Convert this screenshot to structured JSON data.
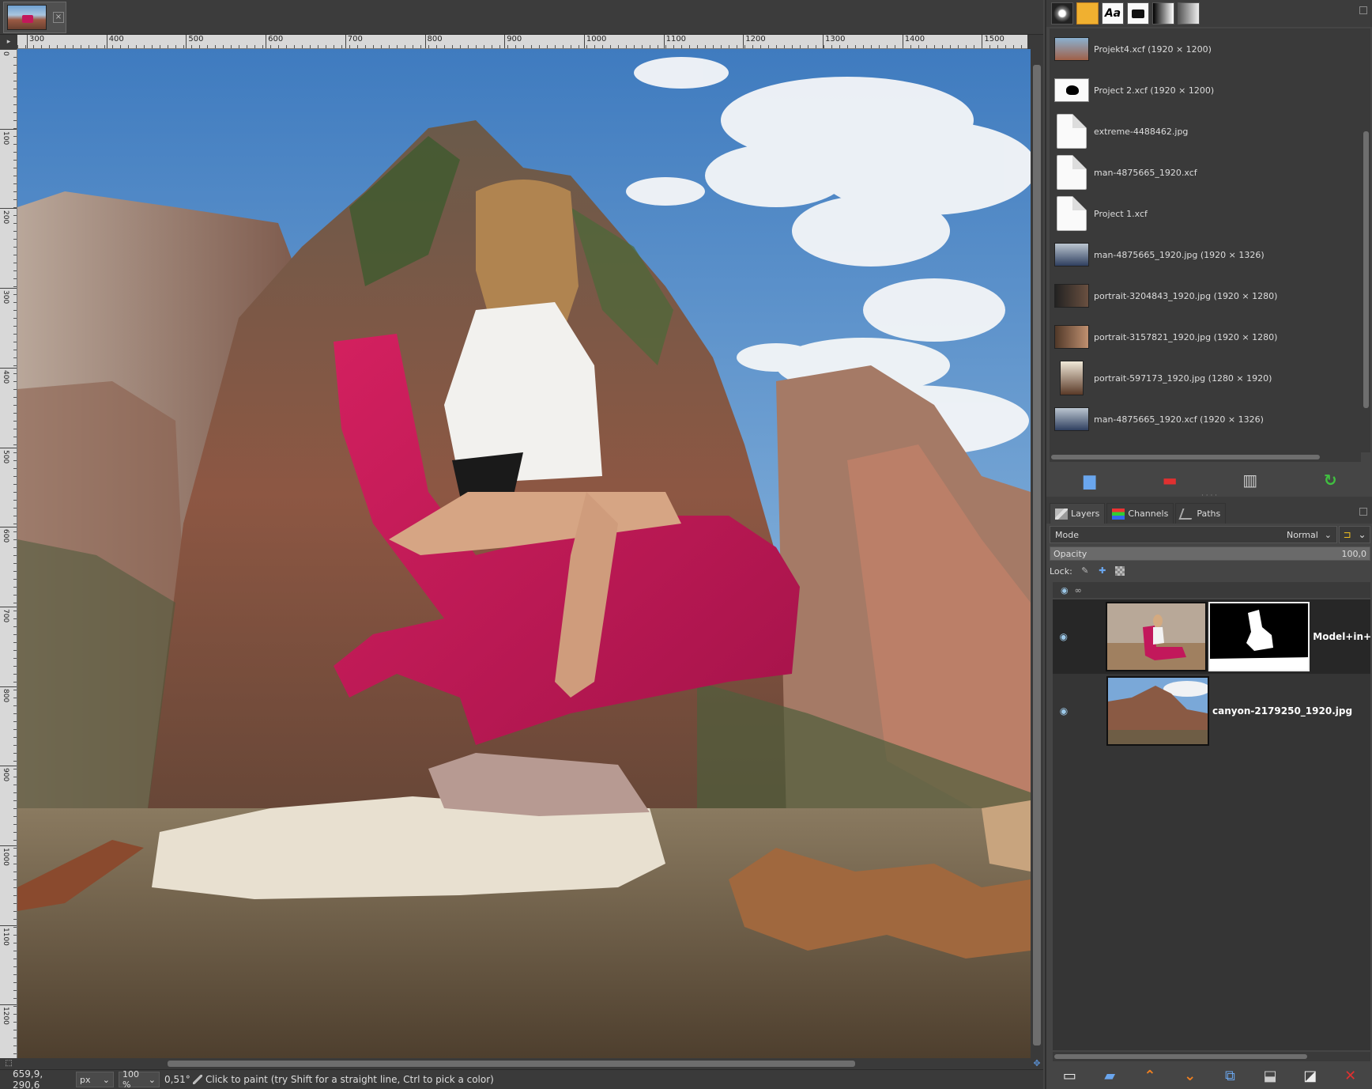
{
  "image_window": {
    "tab_close": "×",
    "ruler_corner": "▸",
    "ruler_h_ticks": [
      "300",
      "400",
      "500",
      "600",
      "700",
      "800",
      "900",
      "1000",
      "1100",
      "1200",
      "1300",
      "1400",
      "1500"
    ],
    "ruler_v_ticks": [
      "0",
      "100",
      "200",
      "300",
      "400",
      "500",
      "600",
      "700",
      "800",
      "900",
      "1000",
      "1100",
      "1200"
    ],
    "nav_icon": "✥"
  },
  "statusbar": {
    "coords": "659,9, 290,6",
    "unit": "px",
    "zoom": "100 %",
    "angle": "0,51°",
    "message": "Click to paint (try Shift for a straight line, Ctrl to pick a color)"
  },
  "images_panel": {
    "items": [
      {
        "label": "Projekt4.xcf (1920 × 1200)",
        "thumb": "photo"
      },
      {
        "label": "Project 2.xcf (1920 × 1200)",
        "thumb": "mask"
      },
      {
        "label": "extreme-4488462.jpg",
        "thumb": "doc"
      },
      {
        "label": "man-4875665_1920.xcf",
        "thumb": "doc"
      },
      {
        "label": "Project 1.xcf",
        "thumb": "doc"
      },
      {
        "label": "man-4875665_1920.jpg (1920 × 1326)",
        "thumb": "photo"
      },
      {
        "label": "portrait-3204843_1920.jpg (1920 × 1280)",
        "thumb": "photo"
      },
      {
        "label": "portrait-3157821_1920.jpg (1920 × 1280)",
        "thumb": "photo"
      },
      {
        "label": "portrait-597173_1920.jpg (1280 × 1920)",
        "thumb": "portrait"
      },
      {
        "label": "man-4875665_1920.xcf (1920 × 1326)",
        "thumb": "photo"
      }
    ]
  },
  "layers_panel": {
    "tabs": {
      "layers": "Layers",
      "channels": "Channels",
      "paths": "Paths"
    },
    "mode_label": "Mode",
    "mode_value": "Normal",
    "opacity_label": "Opacity",
    "opacity_value": "100,0",
    "opacity_fraction": 1.0,
    "lock_label": "Lock:",
    "layers": [
      {
        "name": "Model+in+",
        "visible": true,
        "has_mask": true,
        "selected": true
      },
      {
        "name": "canyon-2179250_1920.jpg",
        "visible": true,
        "has_mask": false,
        "selected": false
      }
    ]
  },
  "colors": {
    "sky": "#5a8fc4",
    "chair": "#c2185b",
    "rock": "#8a5a46",
    "water": "#6e5d45",
    "accent_orange": "#f08020",
    "accent_blue": "#6aa6ee",
    "delete_red": "#e03030",
    "refresh_green": "#40c040"
  },
  "icons": {
    "eye": "eye-icon",
    "chain": "chain-icon",
    "brush": "paintbrush-icon"
  }
}
